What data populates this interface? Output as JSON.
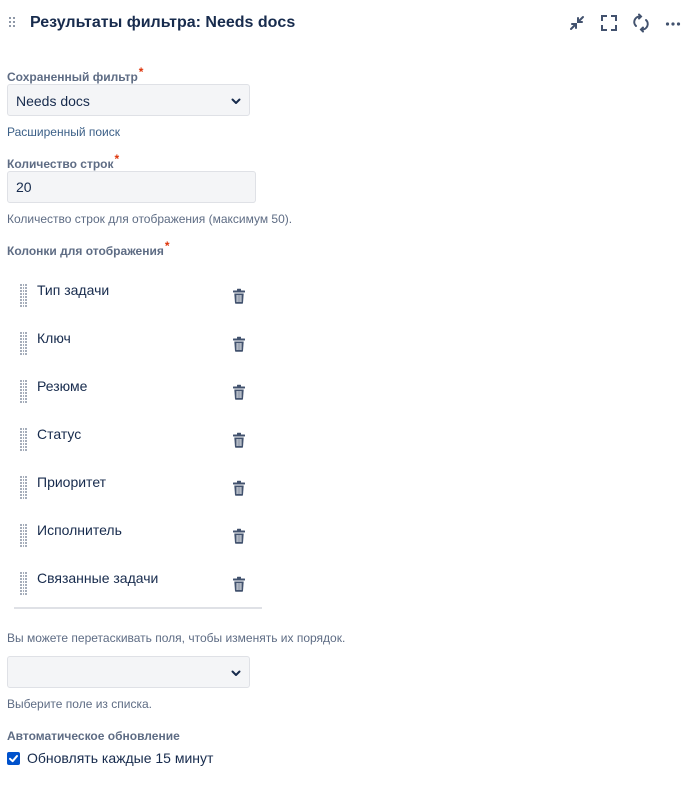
{
  "header": {
    "title": "Результаты фильтра: Needs docs",
    "icons": [
      "drag-handle-icon",
      "minimize-icon",
      "fullscreen-icon",
      "refresh-icon",
      "more-icon"
    ]
  },
  "saved_filter": {
    "label": "Сохраненный фильтр",
    "required_mark": "*",
    "value": "Needs docs",
    "advanced_link": "Расширенный поиск"
  },
  "rows_count": {
    "label": "Количество строк",
    "required_mark": "*",
    "value": "20",
    "help": "Количество строк для отображения (максимум 50)."
  },
  "columns": {
    "label": "Колонки для отображения",
    "required_mark": "*",
    "items": [
      {
        "label": "Тип задачи"
      },
      {
        "label": "Ключ"
      },
      {
        "label": "Резюме"
      },
      {
        "label": "Статус"
      },
      {
        "label": "Приоритет"
      },
      {
        "label": "Исполнитель"
      },
      {
        "label": "Связанные задачи"
      }
    ],
    "reorder_help": "Вы можете перетаскивать поля, чтобы изменять их порядок.",
    "add_field_value": "",
    "add_field_help": "Выберите поле из списка."
  },
  "auto_refresh": {
    "label": "Автоматическое обновление",
    "checkbox_label": "Обновлять каждые 15 минут",
    "checked": true
  },
  "colors": {
    "accent": "#0052cc",
    "required": "#de350b",
    "text": "#172b4d",
    "muted": "#5e6c84"
  }
}
